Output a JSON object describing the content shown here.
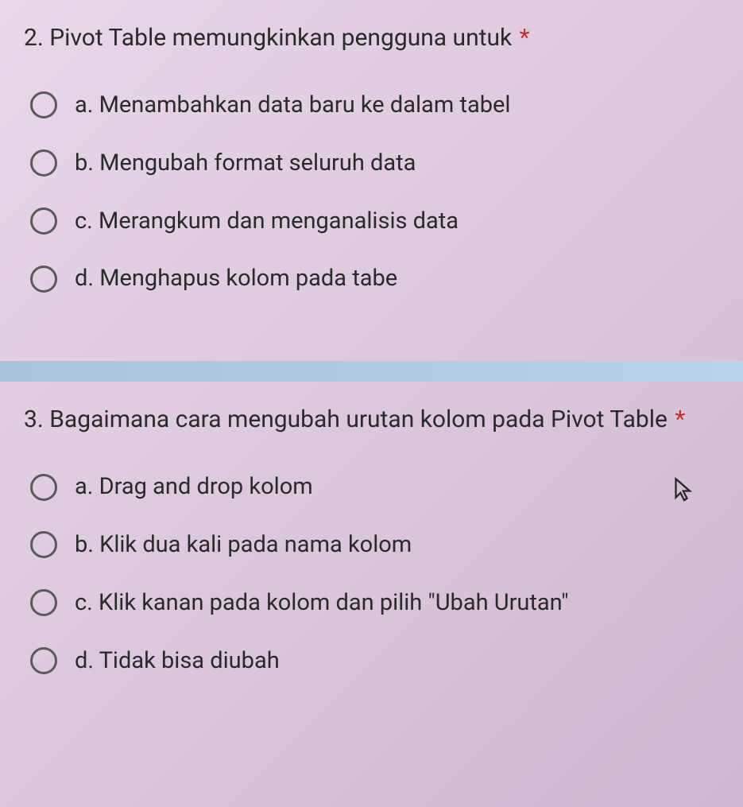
{
  "questions": [
    {
      "number": "2.",
      "text": "Pivot Table memungkinkan pengguna untuk",
      "required": "*",
      "options": [
        {
          "label": "a. Menambahkan data baru ke dalam tabel"
        },
        {
          "label": "b. Mengubah format seluruh data"
        },
        {
          "label": "c. Merangkum dan menganalisis data"
        },
        {
          "label": "d. Menghapus kolom pada tabe"
        }
      ]
    },
    {
      "number": "3.",
      "text": "Bagaimana cara mengubah urutan kolom pada Pivot Table",
      "required": "*",
      "options": [
        {
          "label": "a. Drag and drop kolom"
        },
        {
          "label": "b. Klik dua kali pada nama kolom"
        },
        {
          "label": "c. Klik kanan pada kolom dan pilih \"Ubah Urutan\""
        },
        {
          "label": "d. Tidak bisa diubah"
        }
      ]
    }
  ]
}
